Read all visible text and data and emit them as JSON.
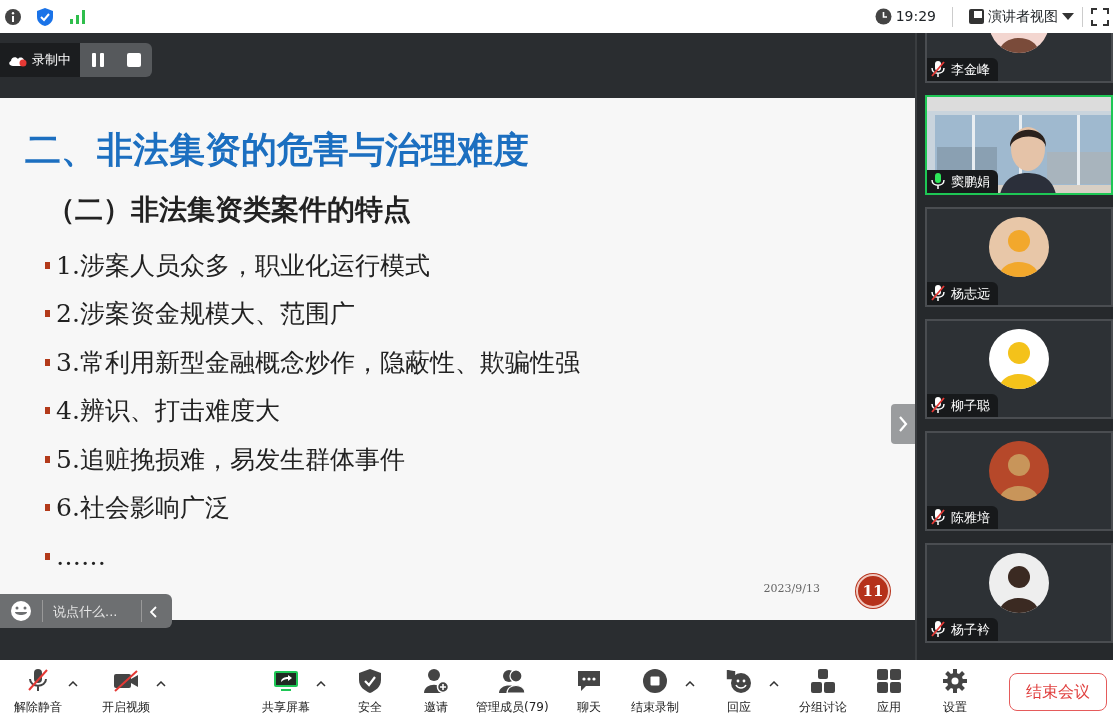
{
  "top_bar": {
    "time": "19:29",
    "view_mode": "演讲者视图"
  },
  "recording": {
    "label": "录制中"
  },
  "slide": {
    "title": "二、非法集资的危害与治理难度",
    "subtitle": "（二）非法集资类案件的特点",
    "bullets": [
      "1.涉案人员众多，职业化运行模式",
      "2.涉案资金规模大、范围广",
      "3.常利用新型金融概念炒作，隐蔽性、欺骗性强",
      "4.辨识、打击难度大",
      "5.追赃挽损难，易发生群体事件",
      "6.社会影响广泛",
      "……"
    ],
    "date": "2023/9/13",
    "page": "11"
  },
  "chat_bar": {
    "placeholder": "说点什么..."
  },
  "participants": [
    {
      "name": "李金峰",
      "mic_on": false,
      "active": false,
      "kind": "avatar"
    },
    {
      "name": "窦鹏娟",
      "mic_on": true,
      "active": true,
      "kind": "video"
    },
    {
      "name": "杨志远",
      "mic_on": false,
      "active": false,
      "kind": "avatar"
    },
    {
      "name": "柳子聪",
      "mic_on": false,
      "active": false,
      "kind": "avatar"
    },
    {
      "name": "陈雅培",
      "mic_on": false,
      "active": false,
      "kind": "avatar"
    },
    {
      "name": "杨子衿",
      "mic_on": false,
      "active": false,
      "kind": "avatar"
    }
  ],
  "toolbar": [
    {
      "label": "解除静音",
      "kind": "mic-off",
      "menu": true
    },
    {
      "label": "开启视频",
      "kind": "video-off",
      "menu": true
    },
    {
      "label": "共享屏幕",
      "kind": "share",
      "menu": true
    },
    {
      "label": "安全",
      "kind": "shield",
      "menu": false
    },
    {
      "label": "邀请",
      "kind": "invite",
      "menu": false
    },
    {
      "label": "管理成员(79)",
      "kind": "members",
      "menu": false
    },
    {
      "label": "聊天",
      "kind": "chat",
      "menu": false
    },
    {
      "label": "结束录制",
      "kind": "stop",
      "menu": true
    },
    {
      "label": "回应",
      "kind": "react",
      "menu": true
    },
    {
      "label": "分组讨论",
      "kind": "breakout",
      "menu": false
    },
    {
      "label": "应用",
      "kind": "apps",
      "menu": false
    },
    {
      "label": "设置",
      "kind": "settings",
      "menu": false
    }
  ],
  "end_button": "结束会议"
}
